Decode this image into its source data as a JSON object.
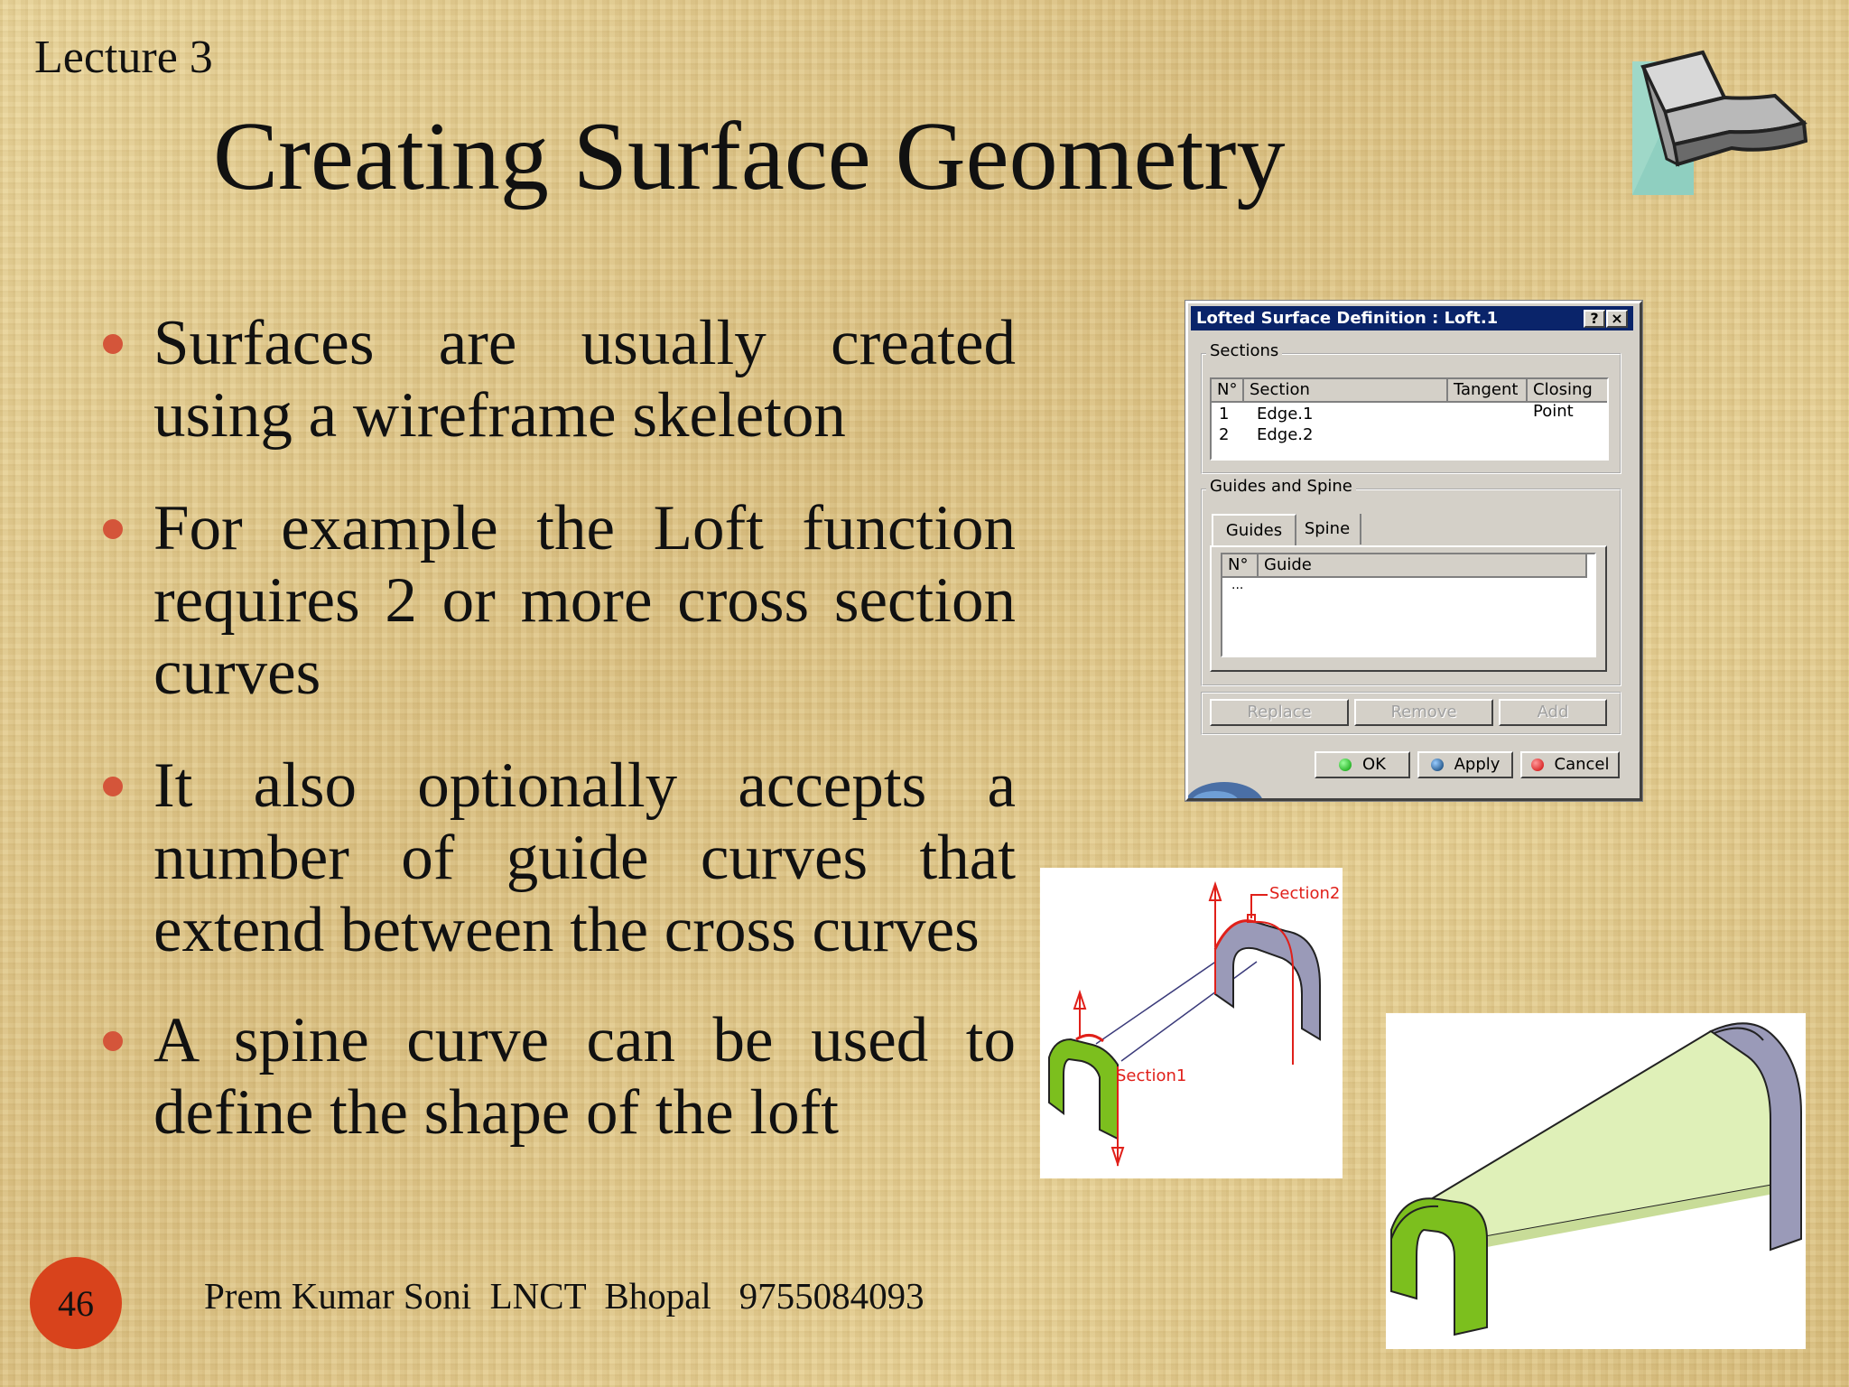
{
  "slide": {
    "lecture_label": "Lecture 3",
    "title": "Creating Surface Geometry",
    "bullets": [
      "Surfaces are usually created using a wireframe skeleton",
      "For example the Loft function requires 2 or more cross section curves",
      "It also optionally accepts a number of guide curves that extend between the cross curves",
      "A spine curve can be used to define the shape of the loft"
    ],
    "bullet_color": "#d4553a",
    "page_number": "46",
    "footer": "Prem Kumar Soni  LNCT  Bhopal   9755084093"
  },
  "dialog": {
    "title": "Lofted Surface Definition : Loft.1",
    "help_btn": "?",
    "close_btn": "×",
    "sections_group": "Sections",
    "sections_columns": [
      "N°",
      "Section",
      "Tangent",
      "Closing Point"
    ],
    "sections_rows": [
      {
        "n": "1",
        "section": "Edge.1"
      },
      {
        "n": "2",
        "section": "Edge.2"
      }
    ],
    "guides_group": "Guides and Spine",
    "tabs": [
      "Guides",
      "Spine"
    ],
    "guide_columns": [
      "N°",
      "Guide"
    ],
    "guide_placeholder": "...",
    "buttons": {
      "replace": "Replace",
      "remove": "Remove",
      "add": "Add",
      "ok": "OK",
      "apply": "Apply",
      "cancel": "Cancel"
    },
    "title_bar_color": "#0a246a"
  },
  "figures": {
    "section1_label": "Section1",
    "section2_label": "Section2",
    "section_color": "#e0201a",
    "green_surface_color": "#7cbf1e",
    "grey_surface_color": "#9a9ab8"
  }
}
